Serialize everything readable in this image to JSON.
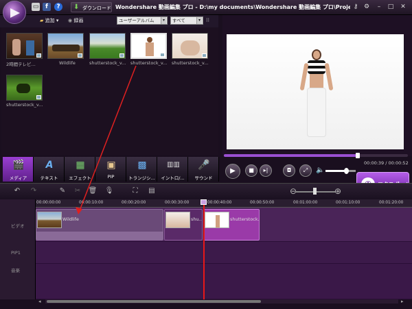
{
  "title_bar": {
    "app_title": "Wondershare 動画編集 プロ - D:\\my documents\\Wondershare 動画編集 プロ\\Projects\\VE プロ",
    "download_label": "ダウンロード",
    "icons": [
      "facebook-icon",
      "help-icon",
      "download-icon",
      "key-icon",
      "gear-icon",
      "minimize-icon",
      "maximize-icon",
      "close-icon"
    ]
  },
  "library_toolbar": {
    "add_label": "追加 ▾",
    "record_label": "録画",
    "album_select": "ユーザーアルバム",
    "filter_select": "すべて"
  },
  "library": {
    "items": [
      {
        "label": "2時間テレビ..."
      },
      {
        "label": "Wildlife"
      },
      {
        "label": "shutterstock_v..."
      },
      {
        "label": "shutterstock_v..."
      },
      {
        "label": "shutterstock_v..."
      },
      {
        "label": "shutterstock_v..."
      }
    ]
  },
  "tabs": [
    {
      "label": "メディア",
      "icon": "media-icon",
      "active": true
    },
    {
      "label": "テキスト",
      "icon": "text-icon",
      "active": false
    },
    {
      "label": "エフェクト",
      "icon": "effect-icon",
      "active": false
    },
    {
      "label": "PIP",
      "icon": "pip-icon",
      "active": false
    },
    {
      "label": "トランジシ...",
      "icon": "transition-icon",
      "active": false
    },
    {
      "label": "イントロ/...",
      "icon": "intro-icon",
      "active": false
    },
    {
      "label": "サウンド",
      "icon": "sound-icon",
      "active": false
    }
  ],
  "preview": {
    "timecode": "00:00:39 / 00:00:52",
    "progress": 0.72,
    "volume": 0.68
  },
  "export": {
    "label": "エクスポート"
  },
  "timeline": {
    "ticks": [
      "00:00:00:00",
      "00:00:10:00",
      "00:00:20:00",
      "00:00:30:00",
      "00:00:40:00",
      "00:00:50:00",
      "00:01:00:00",
      "00:01:10:00",
      "00:01:20:00"
    ],
    "track_labels": [
      "ビデオ",
      "PIP1",
      "音楽"
    ],
    "clips": [
      {
        "label": "Wildlife"
      },
      {
        "label": "shu..."
      },
      {
        "label": "shutterstock..."
      }
    ]
  }
}
